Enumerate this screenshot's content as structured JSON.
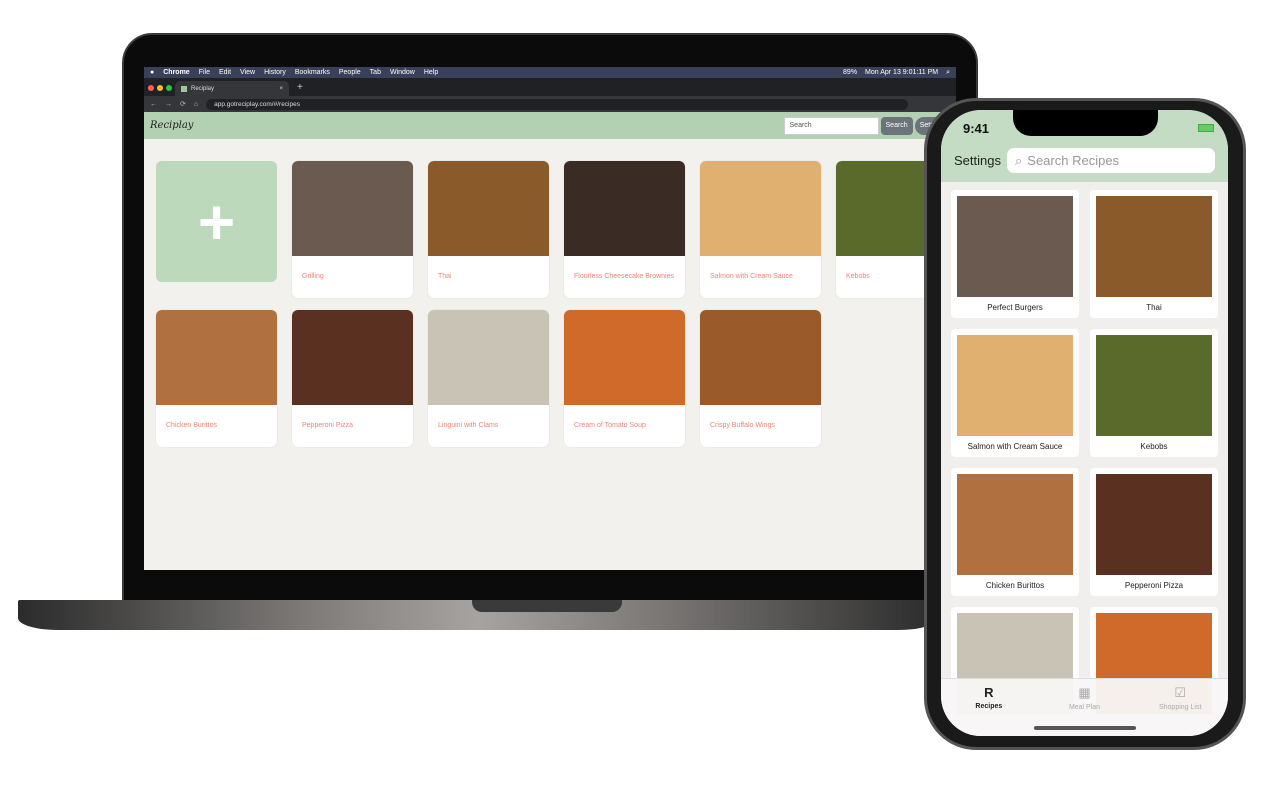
{
  "mac_menu": {
    "apple": "",
    "items": [
      "Chrome",
      "File",
      "Edit",
      "View",
      "History",
      "Bookmarks",
      "People",
      "Tab",
      "Window",
      "Help"
    ],
    "battery": "89%",
    "datetime": "Mon Apr 13  9:01:11 PM"
  },
  "browser": {
    "tab_title": "Reciplay",
    "url": "app.gotreciplay.com/#/recipes",
    "close": "×",
    "new_tab": "+",
    "back": "←",
    "forward": "→",
    "reload": "⟳",
    "home": "⌂",
    "star": "☆"
  },
  "web": {
    "logo": "Reciplay",
    "search_placeholder": "Search",
    "search_button": "Search",
    "settings_button": "Settings",
    "add_label": "+",
    "recipes": [
      {
        "title": "Grilling",
        "color": "#6a5a4f"
      },
      {
        "title": "Thai",
        "color": "#8a5a2a"
      },
      {
        "title": "Flourless Cheesecake Brownies",
        "color": "#3b2b25"
      },
      {
        "title": "Salmon with Cream Sauce",
        "color": "#e0b070"
      },
      {
        "title": "Kebobs",
        "color": "#5a6a2a"
      },
      {
        "title": "Chicken Burittos",
        "color": "#b07040"
      },
      {
        "title": "Pepperoni Pizza",
        "color": "#5a3020"
      },
      {
        "title": "Linguini with Clams",
        "color": "#c9c3b6"
      },
      {
        "title": "Cream of Tomato Soup",
        "color": "#d06a2a"
      },
      {
        "title": "Crispy Buffalo Wings",
        "color": "#9a5a2a"
      }
    ]
  },
  "phone": {
    "time": "9:41",
    "settings": "Settings",
    "search_placeholder": "Search Recipes",
    "recipes": [
      {
        "title": "Perfect Burgers",
        "color": "#6a5a4f"
      },
      {
        "title": "Thai",
        "color": "#8a5a2a"
      },
      {
        "title": "Salmon with Cream Sauce",
        "color": "#e0b070"
      },
      {
        "title": "Kebobs",
        "color": "#5a6a2a"
      },
      {
        "title": "Chicken Burittos",
        "color": "#b07040"
      },
      {
        "title": "Pepperoni Pizza",
        "color": "#5a3020"
      },
      {
        "title": "",
        "color": "#c9c3b6"
      },
      {
        "title": "",
        "color": "#d06a2a"
      }
    ],
    "tabs": [
      {
        "label": "Recipes",
        "icon": "R"
      },
      {
        "label": "Meal Plan",
        "icon": "▦"
      },
      {
        "label": "Shopping List",
        "icon": "☑"
      }
    ]
  }
}
